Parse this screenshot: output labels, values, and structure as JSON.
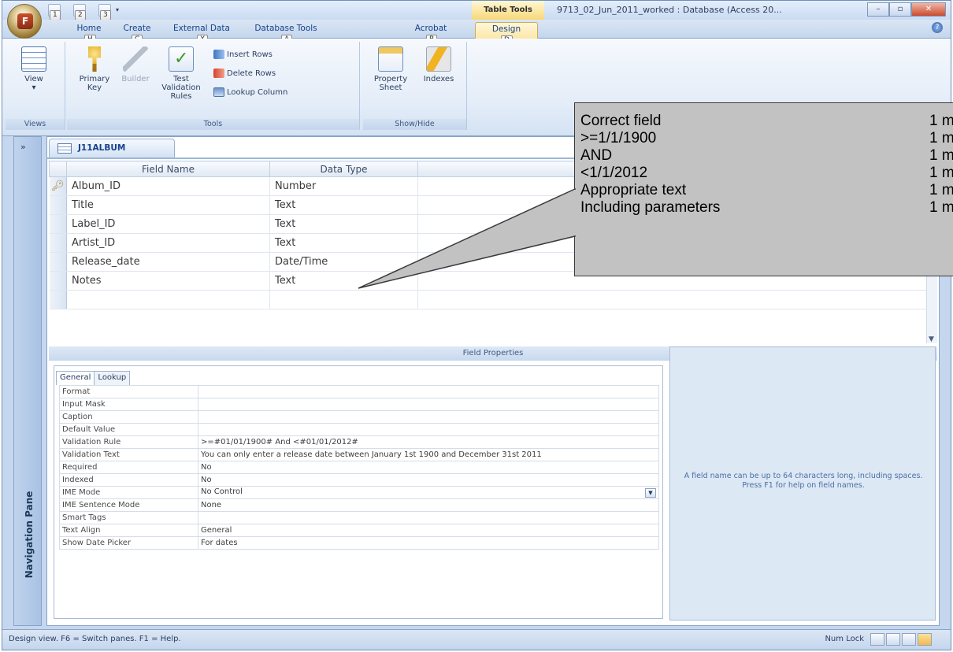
{
  "titlebar": {
    "window_title": "9713_02_Jun_2011_worked : Database (Access 20...",
    "context_tab": "Table Tools",
    "qat_keytips": [
      "1",
      "2",
      "3"
    ],
    "office_keytip": "F"
  },
  "ribbon_tabs": [
    {
      "label": "Home",
      "keytip": "H"
    },
    {
      "label": "Create",
      "keytip": "C"
    },
    {
      "label": "External Data",
      "keytip": "X"
    },
    {
      "label": "Database Tools",
      "keytip": "A"
    },
    {
      "label": "Acrobat",
      "keytip": "B"
    },
    {
      "label": "Design",
      "keytip": "D"
    }
  ],
  "ribbon": {
    "views": {
      "button": "View",
      "group": "Views"
    },
    "tools": {
      "primary_key": "Primary Key",
      "builder": "Builder",
      "test_validation": "Test Validation Rules",
      "insert_rows": "Insert Rows",
      "delete_rows": "Delete Rows",
      "lookup_column": "Lookup Column",
      "group": "Tools"
    },
    "showhide": {
      "property_sheet": "Property Sheet",
      "indexes": "Indexes",
      "group": "Show/Hide"
    }
  },
  "nav_pane": {
    "label": "Navigation Pane",
    "chevron": "»"
  },
  "document": {
    "tab_title": "J11ALBUM",
    "columns": [
      "Field Name",
      "Data Type"
    ],
    "rows": [
      {
        "name": "Album_ID",
        "type": "Number",
        "key": true
      },
      {
        "name": "Title",
        "type": "Text"
      },
      {
        "name": "Label_ID",
        "type": "Text"
      },
      {
        "name": "Artist_ID",
        "type": "Text"
      },
      {
        "name": "Release_date",
        "type": "Date/Time"
      },
      {
        "name": "Notes",
        "type": "Text"
      }
    ]
  },
  "field_properties": {
    "bar_label": "Field Properties",
    "tabs": [
      "General",
      "Lookup"
    ],
    "props": [
      {
        "key": "Format",
        "value": ""
      },
      {
        "key": "Input Mask",
        "value": ""
      },
      {
        "key": "Caption",
        "value": ""
      },
      {
        "key": "Default Value",
        "value": ""
      },
      {
        "key": "Validation Rule",
        "value": ">=#01/01/1900# And <#01/01/2012#"
      },
      {
        "key": "Validation Text",
        "value": "You can only enter a release date between January 1st 1900 and December 31st 2011"
      },
      {
        "key": "Required",
        "value": "No"
      },
      {
        "key": "Indexed",
        "value": "No"
      },
      {
        "key": "IME Mode",
        "value": "No Control"
      },
      {
        "key": "IME Sentence Mode",
        "value": "None"
      },
      {
        "key": "Smart Tags",
        "value": ""
      },
      {
        "key": "Text Align",
        "value": "General"
      },
      {
        "key": "Show Date Picker",
        "value": "For dates"
      }
    ],
    "help": "A field name can be up to 64 characters long, including spaces.  Press F1 for help on field names."
  },
  "statusbar": {
    "left": "Design view.  F6 = Switch panes.  F1 = Help.",
    "num_lock": "Num Lock"
  },
  "callout": {
    "lines": [
      {
        "text": "Correct field",
        "mark": "1 m"
      },
      {
        "text": ">=1/1/1900",
        "mark": "1 m"
      },
      {
        "text": "AND",
        "mark": "1 m"
      },
      {
        "text": "<1/1/2012",
        "mark": "1 m"
      },
      {
        "text": "Appropriate text",
        "mark": "1 m"
      },
      {
        "text": "Including parameters",
        "mark": "1 m"
      }
    ]
  },
  "colors": {
    "frame": "#c5d7ee",
    "accent": "#15428b",
    "callout_fill": "#c2c2c2"
  }
}
